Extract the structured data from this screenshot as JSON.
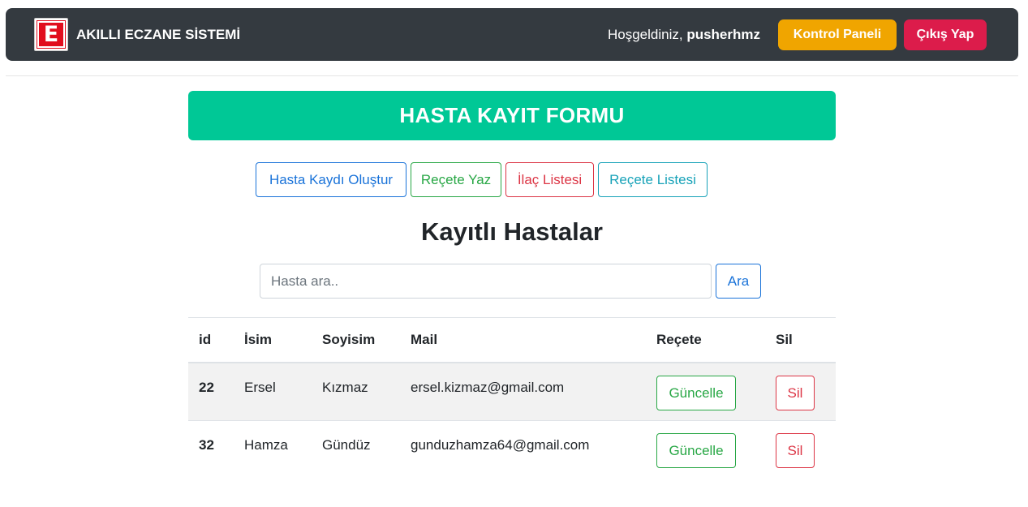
{
  "navbar": {
    "brand": "AKILLI ECZANE SİSTEMİ",
    "logo_letter": "E",
    "welcome_prefix": "Hoşgeldiniz, ",
    "username": "pusherhmz",
    "panel_label": "Kontrol Paneli",
    "logout_label": "Çıkış Yap"
  },
  "banner": {
    "title": "HASTA KAYIT FORMU"
  },
  "actions": {
    "create_patient": "Hasta Kaydı Oluştur",
    "write_prescription": "Reçete Yaz",
    "drug_list": "İlaç Listesi",
    "prescription_list": "Reçete Listesi"
  },
  "section_title": "Kayıtlı Hastalar",
  "search": {
    "placeholder": "Hasta ara..",
    "button_label": "Ara"
  },
  "table": {
    "headers": {
      "id": "id",
      "name": "İsim",
      "surname": "Soyisim",
      "mail": "Mail",
      "prescription": "Reçete",
      "delete": "Sil"
    },
    "rows": [
      {
        "id": "22",
        "name": "Ersel",
        "surname": "Kızmaz",
        "mail": "ersel.kizmaz@gmail.com",
        "update_label": "Güncelle",
        "delete_label": "Sil"
      },
      {
        "id": "32",
        "name": "Hamza",
        "surname": "Gündüz",
        "mail": "gunduzhamza64@gmail.com",
        "update_label": "Güncelle",
        "delete_label": "Sil"
      }
    ]
  },
  "colors": {
    "navbar_bg": "#343a40",
    "banner_bg": "#00c896",
    "panel_button": "#f0a500",
    "logout_button": "#dc1c4b",
    "primary": "#1a73d9",
    "success": "#28a745",
    "danger": "#dc3545",
    "info": "#17a2b8"
  }
}
